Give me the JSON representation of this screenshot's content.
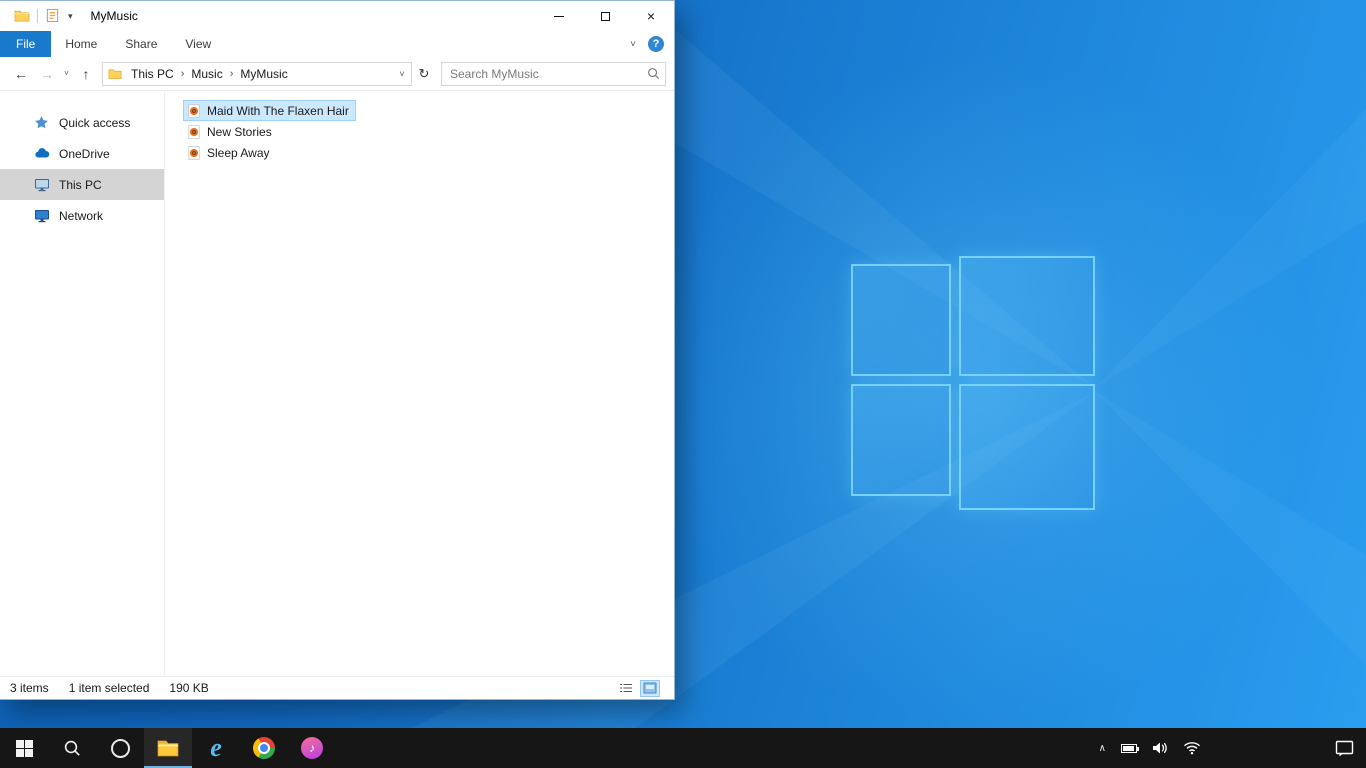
{
  "glyphs": {
    "close": "×",
    "back": "←",
    "forward": "→",
    "up": "↑",
    "refresh": "↻",
    "chevron_down": "˅",
    "qat_chevron": "▾",
    "breadcrumb_separator": "›",
    "ribbon_collapse": "˅",
    "help": "?",
    "tray_chevron": "∧",
    "music_note": "♪",
    "ie_letter": "e"
  },
  "window": {
    "title": "MyMusic"
  },
  "ribbon": {
    "tabs": [
      {
        "label": "File"
      },
      {
        "label": "Home"
      },
      {
        "label": "Share"
      },
      {
        "label": "View"
      }
    ]
  },
  "navbar": {
    "breadcrumb": [
      {
        "label": "This PC"
      },
      {
        "label": "Music"
      },
      {
        "label": "MyMusic"
      }
    ],
    "search_placeholder": "Search MyMusic"
  },
  "sidebar": {
    "items": [
      {
        "label": "Quick access",
        "icon": "quick-access-star"
      },
      {
        "label": "OneDrive",
        "icon": "onedrive-cloud"
      },
      {
        "label": "This PC",
        "icon": "this-pc-monitor",
        "selected": true
      },
      {
        "label": "Network",
        "icon": "network-monitor"
      }
    ]
  },
  "files": [
    {
      "name": "Maid With The Flaxen Hair",
      "icon": "music-file",
      "selected": true
    },
    {
      "name": "New Stories",
      "icon": "music-file",
      "selected": false
    },
    {
      "name": "Sleep Away",
      "icon": "music-file",
      "selected": false
    }
  ],
  "statusbar": {
    "count": "3 items",
    "selected": "1 item selected",
    "size": "190 KB"
  },
  "taskbar": {
    "buttons": [
      "start",
      "search",
      "cortana",
      "file-explorer",
      "internet-explorer",
      "chrome",
      "itunes"
    ],
    "active_button": "file-explorer",
    "tray": [
      "hidden-icons-chevron",
      "battery",
      "volume",
      "wifi",
      "action-center"
    ]
  },
  "colors": {
    "file_tab_blue": "#1979ca",
    "selection_bg": "#cce8ff",
    "selection_border": "#99d1ff",
    "sidebar_selected": "#d4d4d4",
    "taskbar_bg": "#161616",
    "desktop_blue": "#1a7fd4"
  }
}
